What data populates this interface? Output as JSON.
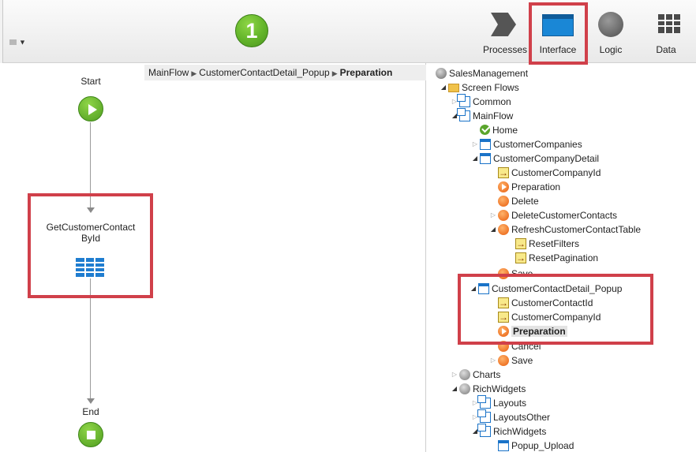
{
  "toolbar": {
    "step_number": "1",
    "tabs": [
      {
        "label": "Processes",
        "icon": "processes-icon"
      },
      {
        "label": "Interface",
        "icon": "interface-icon"
      },
      {
        "label": "Logic",
        "icon": "logic-icon"
      },
      {
        "label": "Data",
        "icon": "data-icon"
      }
    ]
  },
  "breadcrumb": {
    "items": [
      "MainFlow",
      "CustomerContactDetail_Popup"
    ],
    "current": "Preparation"
  },
  "flow": {
    "start_label": "Start",
    "aggregate_label_line1": "GetCustomerContact",
    "aggregate_label_line2": "ById",
    "end_label": "End"
  },
  "tree": [
    {
      "label": "SalesManagement",
      "icon": "module-icon",
      "expander": ""
    },
    {
      "label": "Screen Flows",
      "icon": "folder-icon",
      "expander": "open"
    },
    {
      "label": "Common",
      "icon": "flow-icon",
      "expander": "closed"
    },
    {
      "label": "MainFlow",
      "icon": "flow-icon",
      "expander": "open"
    },
    {
      "label": "Home",
      "icon": "home-screen-icon",
      "expander": ""
    },
    {
      "label": "CustomerCompanies",
      "icon": "screen-icon",
      "expander": "closed"
    },
    {
      "label": "CustomerCompanyDetail",
      "icon": "screen-icon",
      "expander": "open"
    },
    {
      "label": "CustomerCompanyId",
      "icon": "input-parameter-icon",
      "expander": ""
    },
    {
      "label": "Preparation",
      "icon": "preparation-icon",
      "expander": ""
    },
    {
      "label": "Delete",
      "icon": "action-icon",
      "expander": ""
    },
    {
      "label": "DeleteCustomerContacts",
      "icon": "action-icon",
      "expander": "closed"
    },
    {
      "label": "RefreshCustomerContactTable",
      "icon": "action-icon",
      "expander": "open"
    },
    {
      "label": "ResetFilters",
      "icon": "input-parameter-icon",
      "expander": ""
    },
    {
      "label": "ResetPagination",
      "icon": "input-parameter-icon",
      "expander": ""
    },
    {
      "label": "Save",
      "icon": "action-icon",
      "expander": ""
    },
    {
      "label": "CustomerContactDetail_Popup",
      "icon": "screen-icon",
      "expander": "open"
    },
    {
      "label": "CustomerContactId",
      "icon": "input-parameter-icon",
      "expander": ""
    },
    {
      "label": "CustomerCompanyId",
      "icon": "input-parameter-icon",
      "expander": ""
    },
    {
      "label": "Preparation",
      "icon": "preparation-icon",
      "expander": ""
    },
    {
      "label": "Cancel",
      "icon": "action-icon",
      "expander": ""
    },
    {
      "label": "Save",
      "icon": "action-icon",
      "expander": "closed"
    },
    {
      "label": "Charts",
      "icon": "theme-module-icon",
      "expander": "closed"
    },
    {
      "label": "RichWidgets",
      "icon": "theme-module-icon",
      "expander": "open"
    },
    {
      "label": "Layouts",
      "icon": "flow-icon",
      "expander": "closed"
    },
    {
      "label": "LayoutsOther",
      "icon": "flow-icon",
      "expander": "closed"
    },
    {
      "label": "RichWidgets",
      "icon": "flow-icon",
      "expander": "open"
    },
    {
      "label": "Popup_Upload",
      "icon": "screen-icon",
      "expander": ""
    }
  ],
  "colors": {
    "highlight": "#d0404a",
    "accent_blue": "#1a87d6",
    "start_end_green": "#5aa52c",
    "action_orange": "#e85c0c"
  }
}
